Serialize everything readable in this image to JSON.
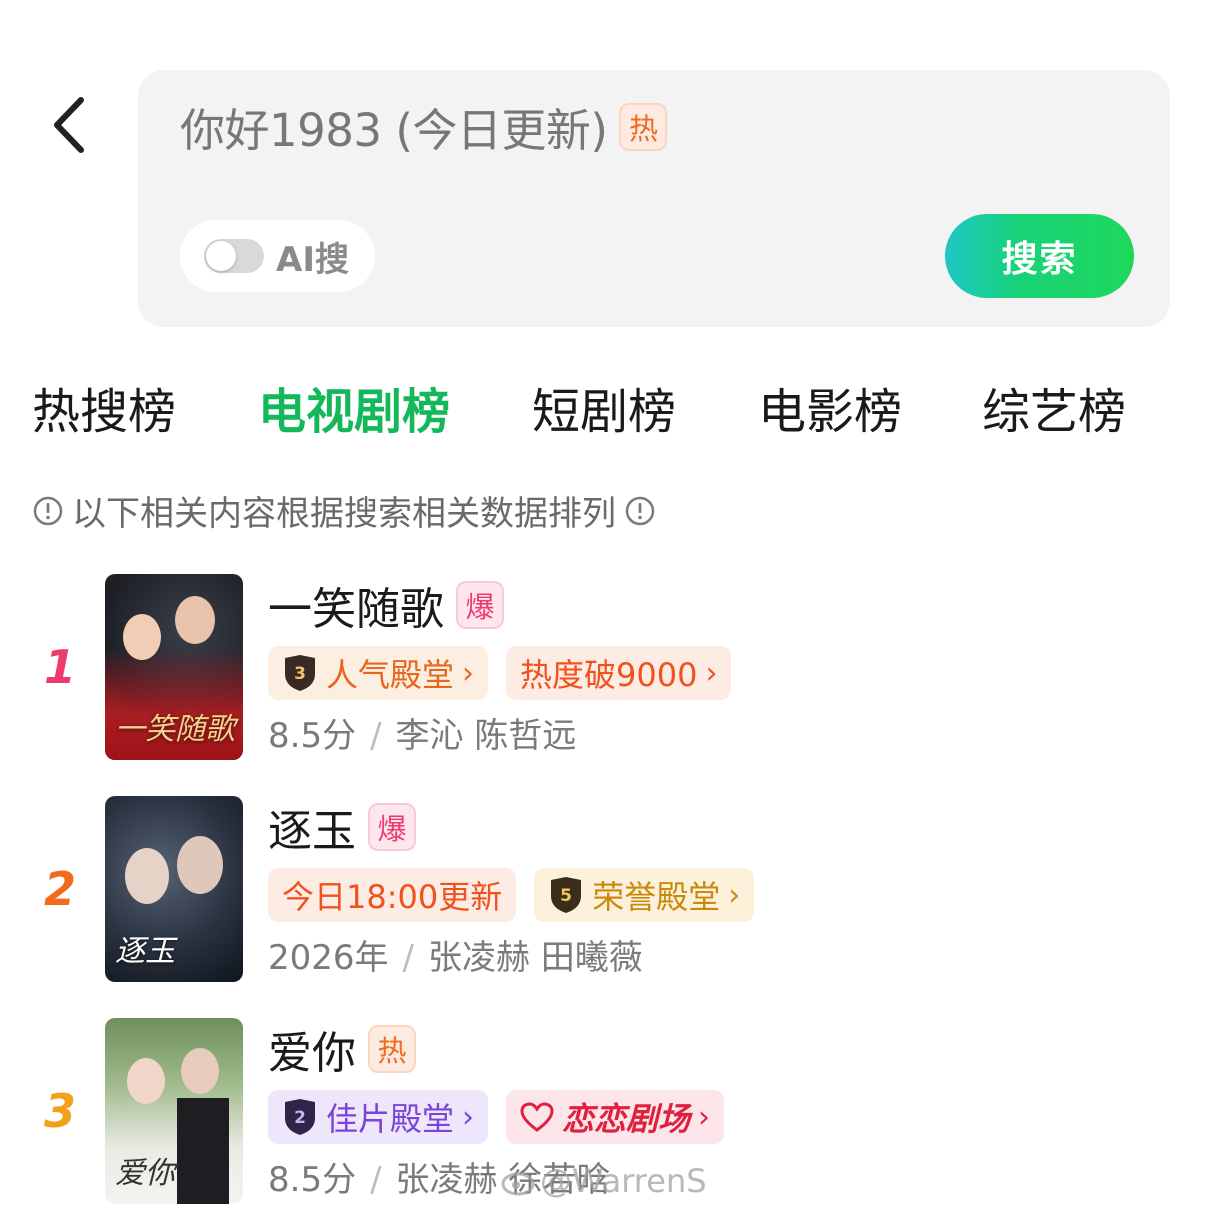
{
  "search": {
    "query": "你好1983 (今日更新)",
    "query_tag": "热",
    "ai_label": "AI搜",
    "ai_enabled": false,
    "search_button": "搜索"
  },
  "tabs": [
    {
      "label": "热搜榜",
      "active": false
    },
    {
      "label": "电视剧榜",
      "active": true
    },
    {
      "label": "短剧榜",
      "active": false
    },
    {
      "label": "电影榜",
      "active": false
    },
    {
      "label": "综艺榜",
      "active": false
    }
  ],
  "notice": "以下相关内容根据搜索相关数据排列",
  "items": [
    {
      "rank": "1",
      "rank_color": "#ee3b6c",
      "poster_text": "一笑随歌",
      "title": "一笑随歌",
      "tag": "爆",
      "badges": [
        {
          "shield": "3",
          "label": "人气殿堂",
          "chev": "›",
          "bg": "#fdeee2",
          "color": "#e8651c"
        },
        {
          "label": "热度破9000",
          "chev": "›",
          "bg": "#fdece4",
          "color": "#f0521e"
        }
      ],
      "meta_left": "8.5分",
      "meta_sep": "/",
      "meta_right": "李沁 陈哲远"
    },
    {
      "rank": "2",
      "rank_color": "#f26a1b",
      "poster_text": "逐玉",
      "title": "逐玉",
      "tag": "爆",
      "badges": [
        {
          "label": "今日18:00更新",
          "bg": "#fdece4",
          "color": "#f0521e"
        },
        {
          "shield": "5",
          "label": "荣誉殿堂",
          "chev": "›",
          "bg": "#fdf1dc",
          "color": "#c98a0c"
        }
      ],
      "meta_left": "2026年",
      "meta_sep": "/",
      "meta_right": "张凌赫 田曦薇"
    },
    {
      "rank": "3",
      "rank_color": "#f4a01a",
      "poster_text": "爱你",
      "title": "爱你",
      "tag": "热",
      "badges": [
        {
          "shield": "2",
          "label": "佳片殿堂",
          "chev": "›",
          "bg": "#eee6fb",
          "color": "#7a45d6"
        },
        {
          "label": "恋恋剧场",
          "chev": "›",
          "bg": "#fde6ea",
          "color": "#e0203f"
        }
      ],
      "meta_left": "8.5分",
      "meta_sep": "/",
      "meta_right": "张凌赫 徐若晗"
    }
  ],
  "watermark": "@WarrenS"
}
